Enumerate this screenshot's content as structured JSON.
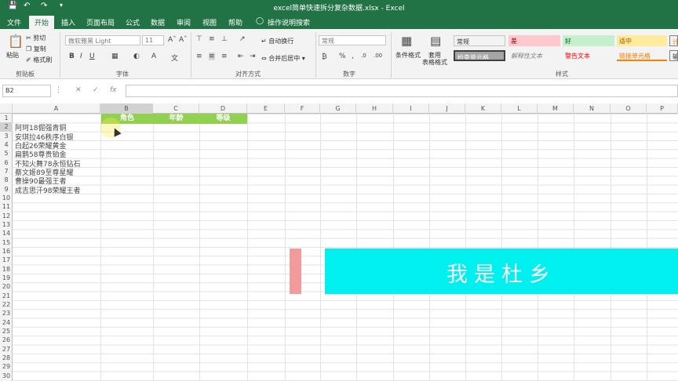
{
  "titlebar": {
    "save_icon": "save-icon",
    "undo_icon": "undo-icon",
    "redo_icon": "redo-icon",
    "title": "excel简单快速拆分复杂数据.xlsx  -  Excel"
  },
  "tabs": [
    "文件",
    "开始",
    "插入",
    "页面布局",
    "公式",
    "数据",
    "审阅",
    "视图",
    "帮助",
    "操作说明搜索"
  ],
  "ribbon": {
    "clipboard": {
      "paste": "粘贴",
      "cut": "剪切",
      "copy": "复制",
      "format_painter": "格式刷",
      "label": "剪贴板"
    },
    "font": {
      "name": "微软雅黑 Light",
      "size": "11",
      "label": "字体"
    },
    "alignment": {
      "wrap": "自动换行",
      "merge": "合并后居中",
      "label": "对齐方式"
    },
    "number": {
      "format": "常规",
      "label": "数字"
    },
    "styles": {
      "conditional": "条件格式",
      "table": "套用\n表格格式",
      "label": "样式",
      "cells": [
        {
          "text": "常规",
          "bg": "#ffffff",
          "color": "#333333"
        },
        {
          "text": "差",
          "bg": "#ffc7ce",
          "color": "#9c0006"
        },
        {
          "text": "好",
          "bg": "#c6efce",
          "color": "#006100"
        },
        {
          "text": "适中",
          "bg": "#ffeb9c",
          "color": "#9c5700"
        },
        {
          "text": "检查单元格",
          "bg": "#a5a5a5",
          "color": "#ffffff"
        },
        {
          "text": "解释性文本",
          "bg": "#f3f3f3",
          "color": "#7f7f7f"
        },
        {
          "text": "警告文本",
          "bg": "#f3f3f3",
          "color": "#ff0000"
        },
        {
          "text": "链接单元格",
          "bg": "#f3f3f3",
          "color": "#fa7d00"
        }
      ]
    }
  },
  "formula_bar": {
    "name_box": "B2",
    "fx": "fx"
  },
  "columns": [
    "A",
    "B",
    "C",
    "D",
    "E",
    "F",
    "G",
    "H",
    "I",
    "J",
    "K",
    "L",
    "M",
    "N",
    "O",
    "P"
  ],
  "rows": [
    "1",
    "2",
    "3",
    "4",
    "5",
    "6",
    "7",
    "8",
    "9",
    "10",
    "11",
    "12",
    "13",
    "14",
    "15",
    "16",
    "17",
    "18",
    "19",
    "20",
    "21",
    "22",
    "23",
    "24",
    "25",
    "26",
    "27",
    "28",
    "29",
    "30"
  ],
  "sheet": {
    "headers": [
      "角色",
      "年龄",
      "等级"
    ],
    "colA": [
      "阿珂18倔强青铜",
      "安琪拉46秩序白银",
      "白起26荣耀黄金",
      "扁鹊58尊贵铂金",
      "不知火舞78永恒钻石",
      "蔡文姬89至尊星耀",
      "曹操90最强王者",
      "成吉思汗98荣耀王者"
    ]
  },
  "banner": {
    "text": "我是杜乡",
    "accent": "#00f0f0",
    "pink": "#f39b9b"
  },
  "header_green": "#92d050"
}
